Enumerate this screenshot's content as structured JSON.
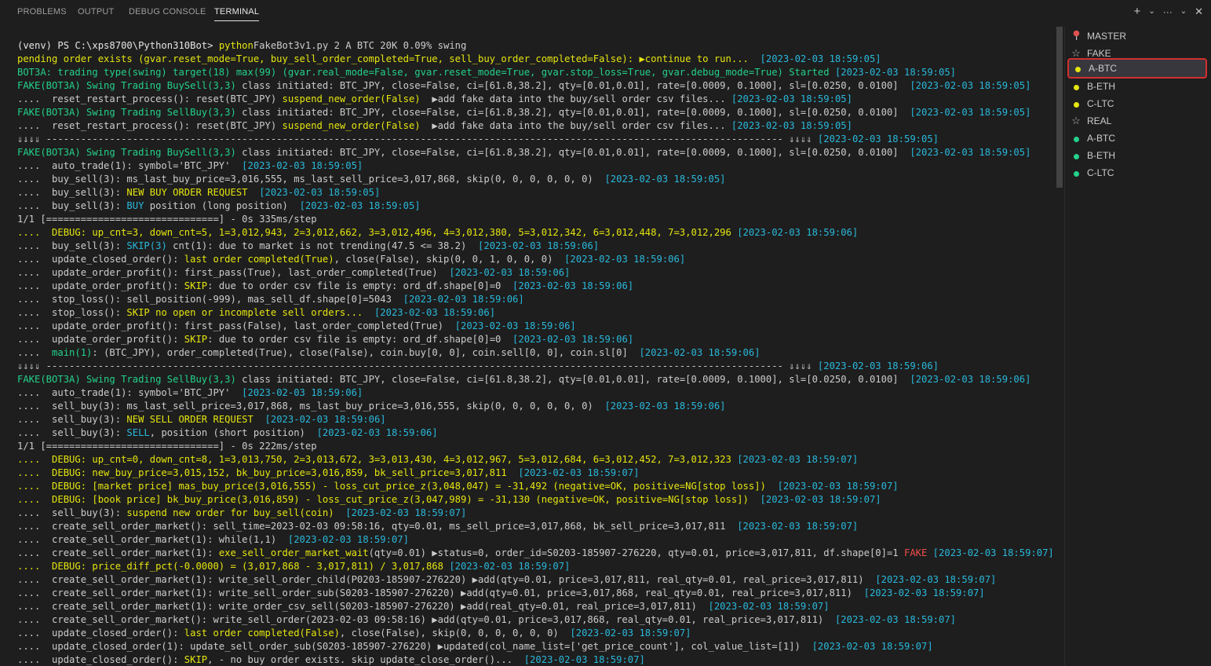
{
  "tabs": [
    "PROBLEMS",
    "OUTPUT",
    "DEBUG CONSOLE",
    "TERMINAL"
  ],
  "active_tab": "TERMINAL",
  "actions": {
    "add": "+",
    "dropdown": "⌄",
    "more": "···",
    "collapse": "⌄",
    "close": "✕"
  },
  "colors": {
    "yellow": "#e5e510",
    "green": "#23d18b",
    "cyan": "#29b8db",
    "red": "#f14c4c",
    "selection_border": "#d32f2f"
  },
  "terminal_lines": [
    [
      [
        "w",
        "(venv) PS C:\\xps8700\\Python310Bot> "
      ],
      [
        "y",
        "python"
      ],
      [
        "",
        "FakeBot3v1.py 2 A BTC 20K 0.09% swing"
      ]
    ],
    [
      [
        "y",
        "pending order exists (gvar.reset_mode=True, buy_sell_order_completed=True, sell_buy_order_completed=False): ▶continue to run...  "
      ],
      [
        "c",
        "[2023-02-03 18:59:05]"
      ]
    ],
    [
      [
        "g",
        "BOT3A: trading type(swing) target(18) max(99) (gvar.real_mode=False, gvar.reset_mode=True, gvar.stop_loss=True, gvar.debug_mode=True) Started "
      ],
      [
        "c",
        "[2023-02-03 18:59:05]"
      ]
    ],
    [
      [
        "g",
        "FAKE(BOT3A) Swing Trading BuySell(3,3) "
      ],
      [
        "",
        "class initiated: BTC_JPY, close=False, ci=[61.8,38.2], qty=[0.01,0.01], rate=[0.0009, 0.1000], sl=[0.0250, 0.0100]  "
      ],
      [
        "c",
        "[2023-02-03 18:59:05]"
      ]
    ],
    [
      [
        "",
        "....  reset_restart_process(): reset(BTC_JPY) "
      ],
      [
        "y",
        "suspend_new_order(False)"
      ],
      [
        "",
        "  ▶add fake data into the buy/sell order csv files... "
      ],
      [
        "c",
        "[2023-02-03 18:59:05]"
      ]
    ],
    [
      [
        "g",
        "FAKE(BOT3A) Swing Trading SellBuy(3,3) "
      ],
      [
        "",
        "class initiated: BTC_JPY, close=False, ci=[61.8,38.2], qty=[0.01,0.01], rate=[0.0009, 0.1000], sl=[0.0250, 0.0100]  "
      ],
      [
        "c",
        "[2023-02-03 18:59:05]"
      ]
    ],
    [
      [
        "",
        "....  reset_restart_process(): reset(BTC_JPY) "
      ],
      [
        "y",
        "suspend_new_order(False)"
      ],
      [
        "",
        "  ▶add fake data into the buy/sell order csv files... "
      ],
      [
        "c",
        "[2023-02-03 18:59:05]"
      ]
    ],
    [
      [
        "",
        "⇓⇓⇓⇓ -------------------------------------------------------------------------------------------------------------------------------- ⇓⇓⇓⇓ "
      ],
      [
        "c",
        "[2023-02-03 18:59:05]"
      ]
    ],
    [
      [
        "g",
        "FAKE(BOT3A) Swing Trading BuySell(3,3) "
      ],
      [
        "",
        "class initiated: BTC_JPY, close=False, ci=[61.8,38.2], qty=[0.01,0.01], rate=[0.0009, 0.1000], sl=[0.0250, 0.0100]  "
      ],
      [
        "c",
        "[2023-02-03 18:59:05]"
      ]
    ],
    [
      [
        "",
        "....  auto_trade(1): symbol='BTC_JPY'  "
      ],
      [
        "c",
        "[2023-02-03 18:59:05]"
      ]
    ],
    [
      [
        "",
        "....  buy_sell(3): ms_last_buy_price=3,016,555, ms_last_sell_price=3,017,868, skip(0, 0, 0, 0, 0, 0)  "
      ],
      [
        "c",
        "[2023-02-03 18:59:05]"
      ]
    ],
    [
      [
        "",
        "....  buy_sell(3): "
      ],
      [
        "y",
        "NEW BUY ORDER REQUEST"
      ],
      [
        "",
        "  "
      ],
      [
        "c",
        "[2023-02-03 18:59:05]"
      ]
    ],
    [
      [
        "",
        "....  buy_sell(3): "
      ],
      [
        "c",
        "BUY"
      ],
      [
        "",
        " position (long position)  "
      ],
      [
        "c",
        "[2023-02-03 18:59:05]"
      ]
    ],
    [
      [
        "",
        "1/1 [==============================] - 0s 335ms/step"
      ]
    ],
    [
      [
        "y",
        "....  DEBUG: up_cnt=3, down_cnt=5, 1=3,012,943, 2=3,012,662, 3=3,012,496, 4=3,012,380, 5=3,012,342, 6=3,012,448, 7=3,012,296 "
      ],
      [
        "c",
        "[2023-02-03 18:59:06]"
      ]
    ],
    [
      [
        "",
        "....  buy_sell(3): "
      ],
      [
        "c",
        "SKIP(3)"
      ],
      [
        "",
        " cnt(1): due to market is not trending(47.5 <= 38.2)  "
      ],
      [
        "c",
        "[2023-02-03 18:59:06]"
      ]
    ],
    [
      [
        "",
        "....  update_closed_order(): "
      ],
      [
        "y",
        "last order completed(True)"
      ],
      [
        "",
        ", close(False), skip(0, 0, 1, 0, 0, 0)  "
      ],
      [
        "c",
        "[2023-02-03 18:59:06]"
      ]
    ],
    [
      [
        "",
        "....  update_order_profit(): first_pass(True), last_order_completed(True)  "
      ],
      [
        "c",
        "[2023-02-03 18:59:06]"
      ]
    ],
    [
      [
        "",
        "....  update_order_profit(): "
      ],
      [
        "y",
        "SKIP"
      ],
      [
        "",
        ": due to order csv file is empty: ord_df.shape[0]=0  "
      ],
      [
        "c",
        "[2023-02-03 18:59:06]"
      ]
    ],
    [
      [
        "",
        "....  stop_loss(): sell_position(-999), mas_sell_df.shape[0]=5043  "
      ],
      [
        "c",
        "[2023-02-03 18:59:06]"
      ]
    ],
    [
      [
        "",
        "....  stop_loss(): "
      ],
      [
        "y",
        "SKIP no open or incomplete sell orders..."
      ],
      [
        "",
        "  "
      ],
      [
        "c",
        "[2023-02-03 18:59:06]"
      ]
    ],
    [
      [
        "",
        "....  update_order_profit(): first_pass(False), last_order_completed(True)  "
      ],
      [
        "c",
        "[2023-02-03 18:59:06]"
      ]
    ],
    [
      [
        "",
        "....  update_order_profit(): "
      ],
      [
        "y",
        "SKIP"
      ],
      [
        "",
        ": due to order csv file is empty: ord_df.shape[0]=0  "
      ],
      [
        "c",
        "[2023-02-03 18:59:06]"
      ]
    ],
    [
      [
        "",
        "....  "
      ],
      [
        "g",
        "main(1)"
      ],
      [
        "",
        ": (BTC_JPY), order_completed(True), close(False), coin.buy[0, 0], coin.sell[0, 0], coin.sl[0]  "
      ],
      [
        "c",
        "[2023-02-03 18:59:06]"
      ]
    ],
    [
      [
        "",
        "⇓⇓⇓⇓ -------------------------------------------------------------------------------------------------------------------------------- ⇓⇓⇓⇓ "
      ],
      [
        "c",
        "[2023-02-03 18:59:06]"
      ]
    ],
    [
      [
        "g",
        "FAKE(BOT3A) Swing Trading SellBuy(3,3) "
      ],
      [
        "",
        "class initiated: BTC_JPY, close=False, ci=[61.8,38.2], qty=[0.01,0.01], rate=[0.0009, 0.1000], sl=[0.0250, 0.0100]  "
      ],
      [
        "c",
        "[2023-02-03 18:59:06]"
      ]
    ],
    [
      [
        "",
        "....  auto_trade(1): symbol='BTC_JPY'  "
      ],
      [
        "c",
        "[2023-02-03 18:59:06]"
      ]
    ],
    [
      [
        "",
        "....  sell_buy(3): ms_last_sell_price=3,017,868, ms_last_buy_price=3,016,555, skip(0, 0, 0, 0, 0, 0)  "
      ],
      [
        "c",
        "[2023-02-03 18:59:06]"
      ]
    ],
    [
      [
        "",
        "....  sell_buy(3): "
      ],
      [
        "y",
        "NEW SELL ORDER REQUEST"
      ],
      [
        "",
        "  "
      ],
      [
        "c",
        "[2023-02-03 18:59:06]"
      ]
    ],
    [
      [
        "",
        "....  sell_buy(3): "
      ],
      [
        "c",
        "SELL"
      ],
      [
        "",
        ", position (short position)  "
      ],
      [
        "c",
        "[2023-02-03 18:59:06]"
      ]
    ],
    [
      [
        "",
        "1/1 [==============================] - 0s 222ms/step"
      ]
    ],
    [
      [
        "y",
        "....  DEBUG: up_cnt=0, down_cnt=8, 1=3,013,750, 2=3,013,672, 3=3,013,430, 4=3,012,967, 5=3,012,684, 6=3,012,452, 7=3,012,323 "
      ],
      [
        "c",
        "[2023-02-03 18:59:07]"
      ]
    ],
    [
      [
        "y",
        "....  DEBUG: new_buy_price=3,015,152, bk_buy_price=3,016,859, bk_sell_price=3,017,811  "
      ],
      [
        "c",
        "[2023-02-03 18:59:07]"
      ]
    ],
    [
      [
        "y",
        "....  DEBUG: [market price] mas_buy_price(3,016,555) - loss_cut_price_z(3,048,047) = -31,492 (negative=OK, positive=NG[stop loss])  "
      ],
      [
        "c",
        "[2023-02-03 18:59:07]"
      ]
    ],
    [
      [
        "y",
        "....  DEBUG: [book price] bk_buy_price(3,016,859) - loss_cut_price_z(3,047,989) = -31,130 (negative=OK, positive=NG[stop loss])  "
      ],
      [
        "c",
        "[2023-02-03 18:59:07]"
      ]
    ],
    [
      [
        "",
        "....  sell_buy(3): "
      ],
      [
        "y",
        "suspend new order for buy_sell(coin)"
      ],
      [
        "",
        "  "
      ],
      [
        "c",
        "[2023-02-03 18:59:07]"
      ]
    ],
    [
      [
        "",
        "....  create_sell_order_market(): sell_time=2023-02-03 09:58:16, qty=0.01, ms_sell_price=3,017,868, bk_sell_price=3,017,811  "
      ],
      [
        "c",
        "[2023-02-03 18:59:07]"
      ]
    ],
    [
      [
        "",
        "....  create_sell_order_market(1): while(1,1)  "
      ],
      [
        "c",
        "[2023-02-03 18:59:07]"
      ]
    ],
    [
      [
        "",
        "....  create_sell_order_market(1): "
      ],
      [
        "y",
        "exe_sell_order_market_wait"
      ],
      [
        "",
        "(qty=0.01) ▶status=0, order_id=S0203-185907-276220, qty=0.01, price=3,017,811, df.shape[0]=1 "
      ],
      [
        "r",
        "FAKE"
      ],
      [
        "c",
        " [2023-02-03 18:59:07]"
      ]
    ],
    [
      [
        "y",
        "....  DEBUG: price_diff_pct(-0.0000) = (3,017,868 - 3,017,811) / 3,017,868 "
      ],
      [
        "c",
        "[2023-02-03 18:59:07]"
      ]
    ],
    [
      [
        "",
        "....  create_sell_order_market(1): write_sell_order_child(P0203-185907-276220) ▶add(qty=0.01, price=3,017,811, real_qty=0.01, real_price=3,017,811)  "
      ],
      [
        "c",
        "[2023-02-03 18:59:07]"
      ]
    ],
    [
      [
        "",
        "....  create_sell_order_market(1): write_sell_order_sub(S0203-185907-276220) ▶add(qty=0.01, price=3,017,868, real_qty=0.01, real_price=3,017,811)  "
      ],
      [
        "c",
        "[2023-02-03 18:59:07]"
      ]
    ],
    [
      [
        "",
        "....  create_sell_order_market(1): write_order_csv_sell(S0203-185907-276220) ▶add(real_qty=0.01, real_price=3,017,811)  "
      ],
      [
        "c",
        "[2023-02-03 18:59:07]"
      ]
    ],
    [
      [
        "",
        "....  create_sell_order_market(): write_sell_order(2023-02-03 09:58:16) ▶add(qty=0.01, price=3,017,868, real_qty=0.01, real_price=3,017,811)  "
      ],
      [
        "c",
        "[2023-02-03 18:59:07]"
      ]
    ],
    [
      [
        "",
        "....  update_closed_order(): "
      ],
      [
        "y",
        "last order completed(False)"
      ],
      [
        "",
        ", close(False), skip(0, 0, 0, 0, 0, 0)  "
      ],
      [
        "c",
        "[2023-02-03 18:59:07]"
      ]
    ],
    [
      [
        "",
        "....  update_closed_order(1): update_sell_order_sub(S0203-185907-276220) ▶updated(col_name_list=['get_price_count'], col_value_list=[1])  "
      ],
      [
        "c",
        "[2023-02-03 18:59:07]"
      ]
    ],
    [
      [
        "",
        "....  update_closed_order(): "
      ],
      [
        "y",
        "SKIP"
      ],
      [
        "",
        ", - no buy order exists. skip update_close_order()...  "
      ],
      [
        "c",
        "[2023-02-03 18:59:07]"
      ]
    ]
  ],
  "sidebar": {
    "items": [
      {
        "label": "MASTER",
        "icon": "pin-icon",
        "kind": "pin",
        "selected": false
      },
      {
        "label": "FAKE",
        "icon": "star-icon",
        "kind": "star",
        "selected": false
      },
      {
        "label": "A-BTC",
        "icon": "dot-icon",
        "kind": "dot",
        "color": "#e5e510",
        "selected": true
      },
      {
        "label": "B-ETH",
        "icon": "dot-icon",
        "kind": "dot",
        "color": "#e5e510",
        "selected": false
      },
      {
        "label": "C-LTC",
        "icon": "dot-icon",
        "kind": "dot",
        "color": "#e5e510",
        "selected": false
      },
      {
        "label": "REAL",
        "icon": "star-icon",
        "kind": "star",
        "selected": false
      },
      {
        "label": "A-BTC",
        "icon": "dot-icon",
        "kind": "dot",
        "color": "#23d18b",
        "selected": false
      },
      {
        "label": "B-ETH",
        "icon": "dot-icon",
        "kind": "dot",
        "color": "#23d18b",
        "selected": false
      },
      {
        "label": "C-LTC",
        "icon": "dot-icon",
        "kind": "dot",
        "color": "#23d18b",
        "selected": false
      }
    ]
  }
}
